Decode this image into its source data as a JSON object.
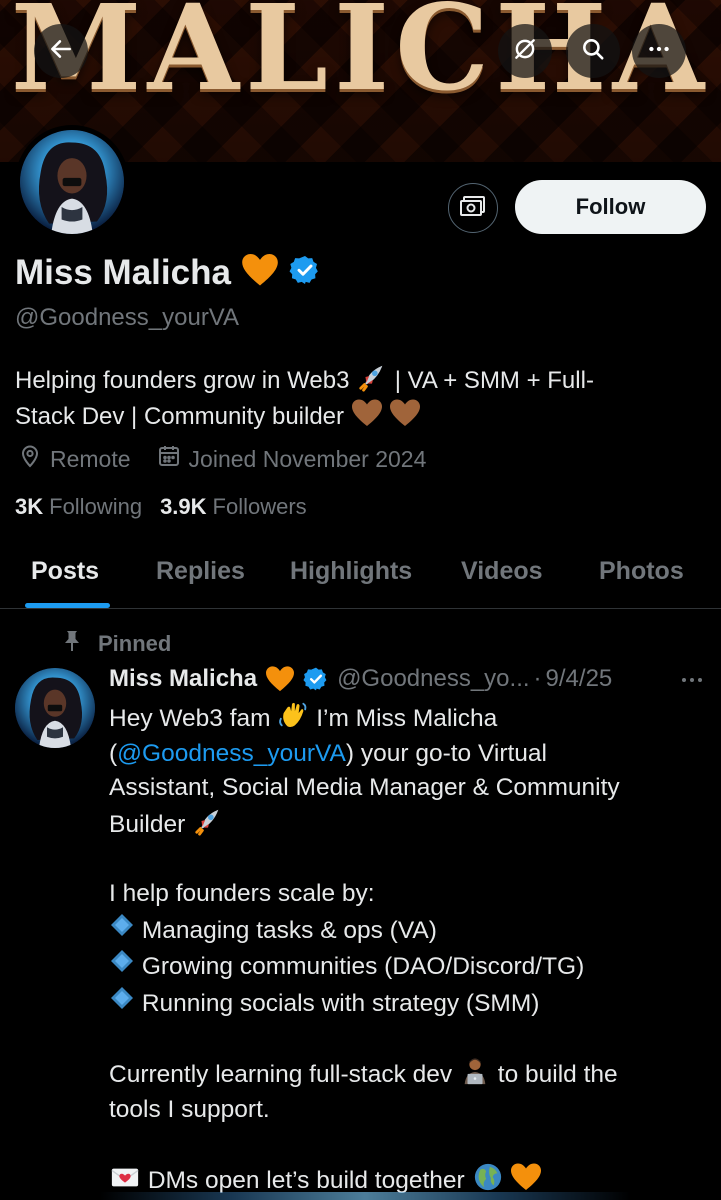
{
  "banner": {
    "title": "MALICHA"
  },
  "header_buttons": {
    "back_icon": "arrow-left-icon",
    "grok_icon": "grok-icon",
    "search_icon": "search-icon",
    "more_icon": "more-icon"
  },
  "profile": {
    "display_name": "Miss Malicha",
    "name_emoji": "orange-heart",
    "verified": true,
    "handle": "@Goodness_yourVA",
    "bio_line1": "Helping founders grow in Web3",
    "bio_line1_tail": "| VA + SMM + Full-",
    "bio_line2": "Stack Dev | Community builder",
    "location": "Remote",
    "joined": "Joined November 2024",
    "following_count": "3K",
    "following_label": "Following",
    "followers_count": "3.9K",
    "followers_label": "Followers",
    "follow_button": "Follow"
  },
  "tabs": [
    {
      "label": "Posts",
      "active": true
    },
    {
      "label": "Replies",
      "active": false
    },
    {
      "label": "Highlights",
      "active": false
    },
    {
      "label": "Videos",
      "active": false
    },
    {
      "label": "Photos",
      "active": false
    }
  ],
  "post": {
    "pinned_label": "Pinned",
    "author_name": "Miss Malicha",
    "author_handle": "@Goodness_yo...",
    "separator": "·",
    "date": "9/4/25",
    "line1": "Hey Web3 fam",
    "line1_tail": "I’m Miss Malicha",
    "line2_open": "(",
    "line2_mention": "@Goodness_yourVA",
    "line2_tail": ") your go-to Virtual",
    "line3": "Assistant, Social Media Manager & Community",
    "line4": "Builder",
    "line5": "I help founders scale by:",
    "bullets": [
      "Managing tasks & ops (VA)",
      "Growing communities (DAO/Discord/TG)",
      "Running socials with strategy (SMM)"
    ],
    "line6": "Currently learning full-stack dev",
    "line6_tail": "to build the",
    "line7": "tools I support.",
    "line8": "DMs open let’s build together"
  },
  "colors": {
    "accent": "#1d9bf0",
    "muted": "#71767b",
    "text": "#e7e9ea",
    "background": "#000000",
    "orange_heart": "#f4900c",
    "brown_heart": "#a0643a"
  }
}
